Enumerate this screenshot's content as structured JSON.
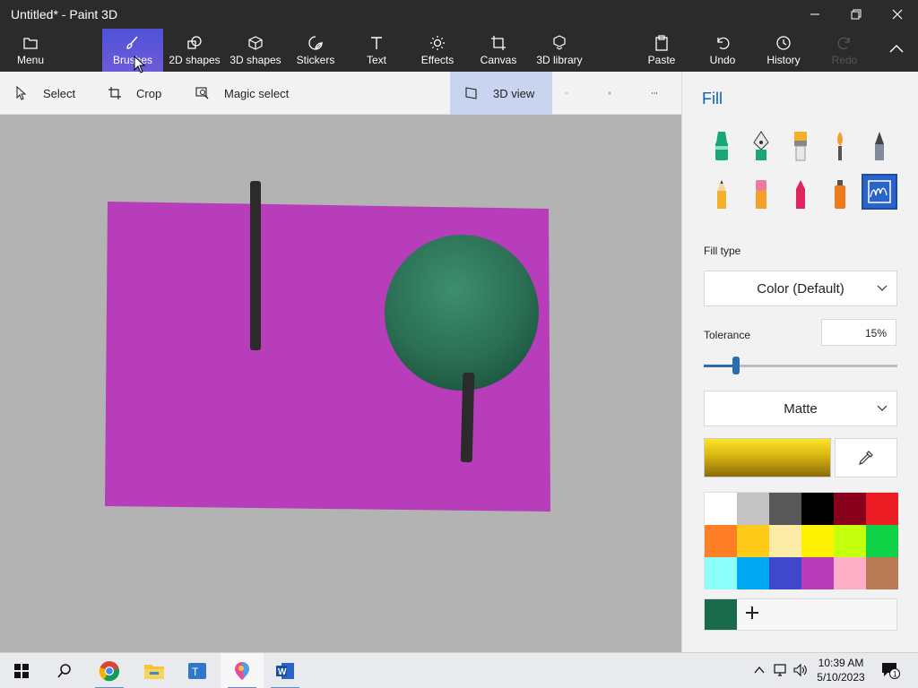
{
  "app": {
    "title": "Untitled* - Paint 3D"
  },
  "ribbon": {
    "menu": "Menu",
    "brushes": "Brushes",
    "shapes2d": "2D shapes",
    "shapes3d": "3D shapes",
    "stickers": "Stickers",
    "text": "Text",
    "effects": "Effects",
    "canvas": "Canvas",
    "library3d": "3D library",
    "paste": "Paste",
    "undo": "Undo",
    "history": "History",
    "redo": "Redo"
  },
  "toolbar": {
    "select": "Select",
    "crop": "Crop",
    "magic_select": "Magic select",
    "view3d": "3D view"
  },
  "panel": {
    "title": "Fill",
    "fill_type_label": "Fill type",
    "fill_type_value": "Color (Default)",
    "tolerance_label": "Tolerance",
    "tolerance_value": "15%",
    "tolerance_fraction": 0.15,
    "finish_value": "Matte",
    "brushes": [
      "marker-icon",
      "calligraphy-pen-icon",
      "oil-brush-icon",
      "watercolor-icon",
      "pixel-pen-icon",
      "pencil-icon",
      "eraser-icon",
      "crayon-icon",
      "spray-can-icon",
      "fill-icon"
    ],
    "palette": [
      "#ffffff",
      "#c3c3c3",
      "#585858",
      "#000000",
      "#88001b",
      "#ec1c24",
      "#ff7f27",
      "#ffca18",
      "#fdeca6",
      "#fff200",
      "#c4ff0e",
      "#0ed145",
      "#8cfffb",
      "#00a8f3",
      "#3f48cc",
      "#b83dba",
      "#ffaec8",
      "#b97a56"
    ],
    "current_color": "#1a6b4b"
  },
  "colors": {
    "accent": "#0a63b7",
    "active_tool": "#4f52d6",
    "canvas_bg": "#b3b3b3",
    "rectangle": "#b83dba",
    "sphere": "#2e7d5e"
  },
  "taskbar": {
    "time": "10:39 AM",
    "date": "5/10/2023",
    "notifications": "1"
  }
}
